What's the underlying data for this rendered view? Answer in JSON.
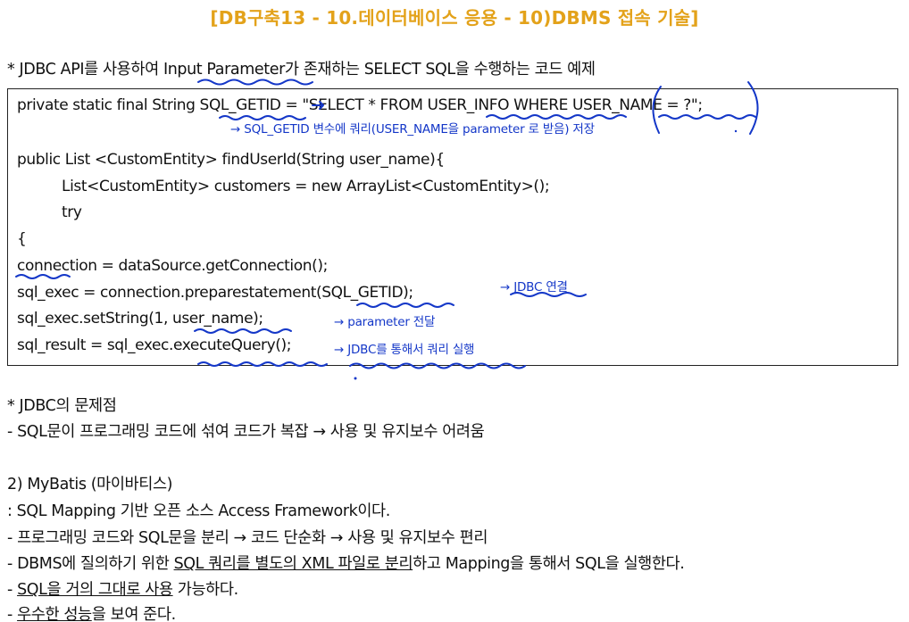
{
  "title": "[DB구축13 - 10.데이터베이스 응용 - 10)DBMS 접속 기술]",
  "intro": "* JDBC API를 사용하여 Input Parameter가 존재하는 SELECT SQL을 수행하는 코드 예제",
  "code": {
    "line1": "private static final String SQL_GETID = \"SELECT * FROM USER_INFO WHERE USER_NAME = ?\";",
    "line2": "public List <CustomEntity> findUserId(String user_name){",
    "line3": "List<CustomEntity> customers = new ArrayList<CustomEntity>();",
    "line4": "try",
    "line5": "{",
    "line6": "connection = dataSource.getConnection();",
    "line7": "sql_exec = connection.preparestatement(SQL_GETID);",
    "line8": "sql_exec.setString(1, user_name);",
    "line9": "sql_result = sql_exec.executeQuery();"
  },
  "notes": {
    "note1": "→ SQL_GETID 변수에 쿼리(USER_NAME을 parameter 로 받음) 저장",
    "note2": "→ JDBC 연결",
    "note3": "→ parameter 전달",
    "note4": "→ JDBC를 통해서 쿼리 실행"
  },
  "problems": {
    "heading": "* JDBC의 문제점",
    "item1": "- SQL문이 프로그래밍 코드에 섞여 코드가 복잡 → 사용 및 유지보수 어려움"
  },
  "mybatis": {
    "heading": "2) MyBatis (마이바티스)",
    "def": ": SQL Mapping 기반 오픈 소스 Access Framework이다.",
    "item1": "- 프로그래밍 코드와 SQL문을 분리 → 코드 단순화 → 사용 및 유지보수 편리",
    "item2_pre": "- DBMS에 질의하기 위한 ",
    "item2_ul": "SQL 쿼리를 별도의 XML 파일로 분리",
    "item2_post": "하고 Mapping을 통해서 SQL을 실행한다.",
    "item3_pre": "- ",
    "item3_ul": "SQL을 거의 그대로 사용",
    "item3_post": " 가능하다.",
    "item4_pre": "- ",
    "item4_ul": "우수한 성능",
    "item4_post": "을 보여 준다."
  },
  "colors": {
    "title": "#e3a21a",
    "ink": "#1437c8"
  }
}
